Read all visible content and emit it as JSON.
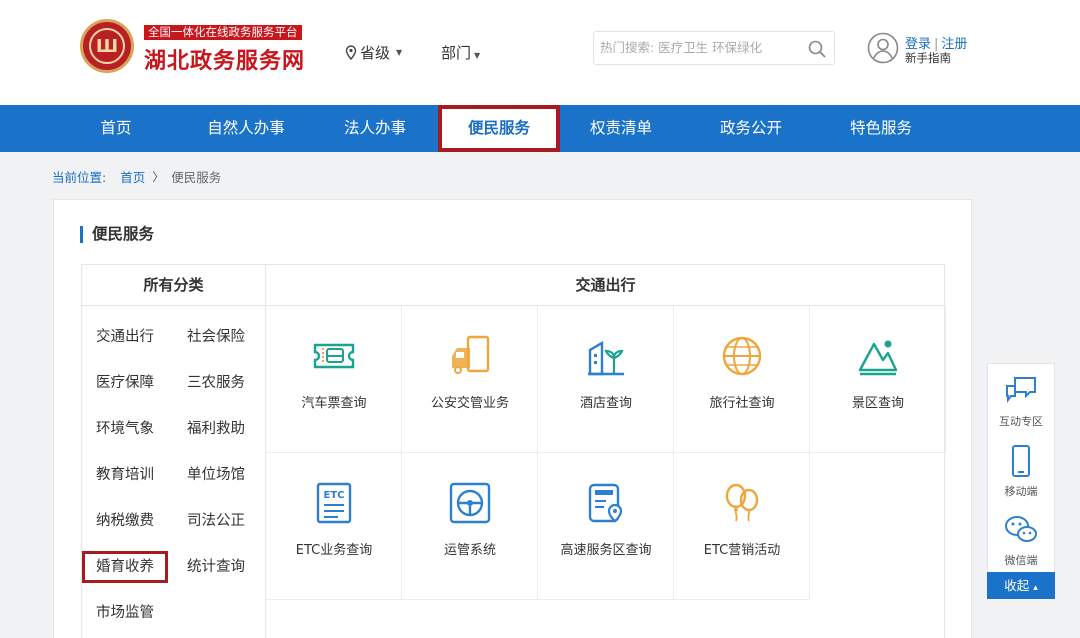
{
  "header": {
    "platform_tag": "全国一体化在线政务服务平台",
    "site_title": "湖北政务服务网",
    "logo_glyph": "Ш",
    "region_select": "省级",
    "dept_select": "部门",
    "search_placeholder": "热门搜索: 医疗卫生 环保绿化",
    "login": "登录",
    "separator": "|",
    "register": "注册",
    "guide": "新手指南"
  },
  "nav": {
    "items": [
      "首页",
      "自然人办事",
      "法人办事",
      "便民服务",
      "权责清单",
      "政务公开",
      "特色服务"
    ],
    "active": "便民服务"
  },
  "breadcrumb": {
    "prefix": "当前位置:",
    "home": "首页",
    "arrow": "〉",
    "current": "便民服务"
  },
  "panel": {
    "title": "便民服务",
    "category_header": "所有分类",
    "categories": [
      "交通出行",
      "社会保险",
      "医疗保障",
      "三农服务",
      "环境气象",
      "福利救助",
      "教育培训",
      "单位场馆",
      "纳税缴费",
      "司法公正",
      "婚育收养",
      "统计查询",
      "市场监管"
    ],
    "highlighted_category": "婚育收养",
    "service_header": "交通出行",
    "services": [
      "汽车票查询",
      "公安交管业务",
      "酒店查询",
      "旅行社查询",
      "景区查询",
      "ETC业务查询",
      "运管系统",
      "高速服务区查询",
      "ETC营销活动"
    ]
  },
  "sidebar": {
    "items": [
      "互动专区",
      "移动端",
      "微信端"
    ],
    "collapse": "收起",
    "collapse_icon": "▴"
  },
  "colors": {
    "brand_blue": "#1b73c9",
    "brand_red": "#c8161d",
    "highlight_border": "#a61b1f",
    "icon_teal": "#1aa38f",
    "icon_orange": "#f0a53a",
    "icon_blue": "#2d7fd0"
  }
}
